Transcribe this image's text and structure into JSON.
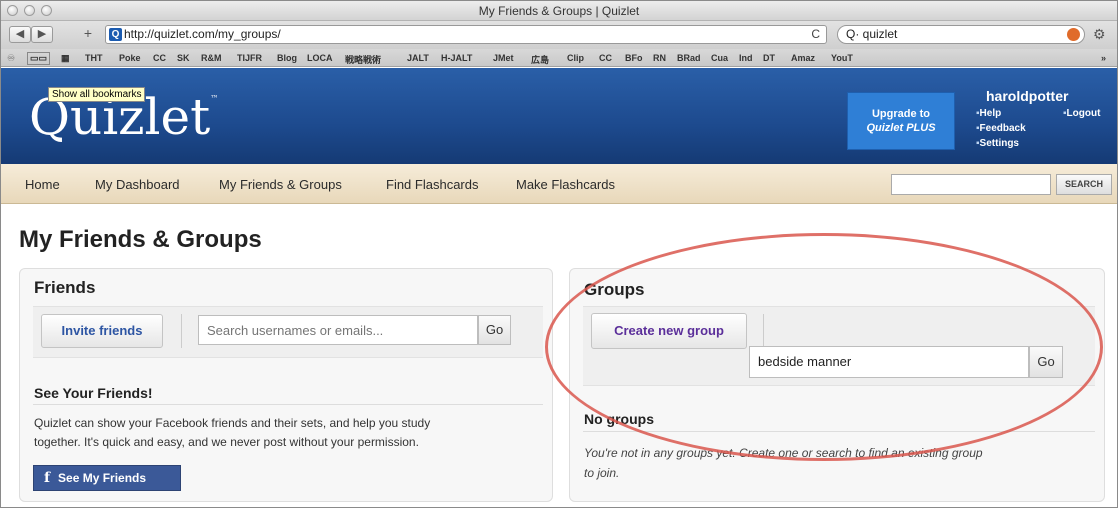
{
  "window": {
    "title": "My Friends & Groups | Quizlet"
  },
  "toolbar": {
    "back": "◀",
    "forward": "▶",
    "add": "+",
    "url": "http://quizlet.com/my_groups/",
    "reload": "C",
    "search_value": "Q· quizlet",
    "gear": "⚙"
  },
  "bookmarks": [
    "THT",
    "Poke",
    "CC",
    "SK",
    "R&M",
    "TIJFR",
    "Blog",
    "LOCA",
    "戦略戦術",
    "JALT",
    "H-JALT",
    "JMet",
    "広島",
    "Clip",
    "CC",
    "BFo",
    "RN",
    "BRad",
    "Cua",
    "Ind",
    "DT",
    "Amaz",
    "YouT"
  ],
  "bookmark_tooltip": "Show all bookmarks",
  "header": {
    "logo": "Quizlet",
    "tm": "™",
    "upgrade_line1": "Upgrade to",
    "upgrade_line2": "Quizlet PLUS",
    "username": "haroldpotter",
    "links": {
      "help": "Help",
      "logout": "Logout",
      "feedback": "Feedback",
      "settings": "Settings"
    }
  },
  "nav": {
    "items": [
      "Home",
      "My Dashboard",
      "My Friends & Groups",
      "Find Flashcards",
      "Make Flashcards"
    ],
    "search_button": "SEARCH"
  },
  "page": {
    "title": "My Friends & Groups"
  },
  "friends": {
    "heading": "Friends",
    "invite_button": "Invite friends",
    "search_placeholder": "Search usernames or emails...",
    "go": "Go",
    "see_heading": "See Your Friends!",
    "description_line1": "Quizlet can show your Facebook friends and their sets, and help you study",
    "description_line2": "together. It's quick and easy, and we never post without your permission.",
    "fb_button": "See My Friends",
    "fb_icon": "f"
  },
  "groups": {
    "heading": "Groups",
    "create_button": "Create new group",
    "search_value": "bedside manner",
    "go": "Go",
    "no_groups_heading": "No groups",
    "no_groups_line1": "You're not in any groups yet. Create one or search to find an existing group",
    "no_groups_line2": "to join."
  },
  "colors": {
    "header": "#1d4a8e",
    "nav": "#efe2c8",
    "accent_link": "#2d55a3",
    "facebook": "#3b5998",
    "annotation": "#d9574e"
  }
}
